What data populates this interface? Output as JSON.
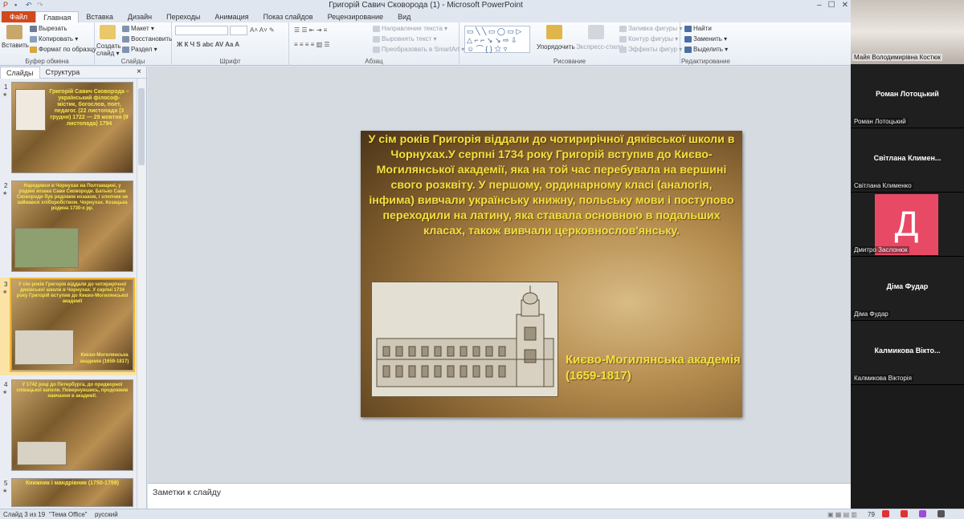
{
  "window": {
    "title": "Григорій Савич Сковорода (1) - Microsoft PowerPoint",
    "minimize": "–",
    "maximize": "☐",
    "close": "✕"
  },
  "tabs": {
    "file": "Файл",
    "items": [
      "Главная",
      "Вставка",
      "Дизайн",
      "Переходы",
      "Анимация",
      "Показ слайдов",
      "Рецензирование",
      "Вид"
    ]
  },
  "ribbon": {
    "clipboard": {
      "label": "Буфер обмена",
      "paste": "Вставить",
      "cut": "Вырезать",
      "copy": "Копировать ▾",
      "format_painter": "Формат по образцу"
    },
    "slides": {
      "label": "Слайды",
      "new_slide": "Создать слайд ▾",
      "layout": "Макет ▾",
      "reset": "Восстановить",
      "section": "Раздел ▾"
    },
    "font": {
      "label": "Шрифт"
    },
    "paragraph": {
      "label": "Абзац",
      "text_direction": "Направление текста ▾",
      "align_text": "Выровнять текст ▾",
      "smartart": "Преобразовать в SmartArt ▾"
    },
    "drawing": {
      "label": "Рисование",
      "arrange": "Упорядочить",
      "quick_styles": "Экспресс-стили",
      "fill": "Заливка фигуры ▾",
      "outline": "Контур фигуры ▾",
      "effects": "Эффекты фигур ▾"
    },
    "editing": {
      "label": "Редактирование",
      "find": "Найти",
      "replace": "Заменить ▾",
      "select": "Выделить ▾"
    }
  },
  "panel": {
    "tab_slides": "Слайды",
    "tab_outline": "Структура",
    "close": "×",
    "thumbnails": [
      {
        "number": "1",
        "text": "Григорій Савич Сковорода – український філософ-містик, богослов, поет, педагог. (22 листопада (3 грудня) 1722 — 29 жовтня (9 листопада) 1794"
      },
      {
        "number": "2",
        "text": "Народився в Чорнухах на Полтавщині, у родині козака Сави Сковороди. Батько Сави Сковороди був рядовим козаком, і хлопчик не займався хліборобством. Чорнухах. Козацька родина 1730-х рр."
      },
      {
        "number": "3",
        "text": "У сім років Григорія віддали до чотирирічної дяківської школи в Чорнухах. У серпні 1734 року Григорій вступив до Києво-Могилянської академії",
        "caption": "Києво-Могилянська академія (1659-1817)"
      },
      {
        "number": "4",
        "text": "У 1742 році до Петербурга, до придворної співацької капели. Повернувшись, продовжив навчання в академії."
      },
      {
        "number": "5",
        "text": "Книжник і мандрівник (1750-1759)"
      }
    ]
  },
  "slide": {
    "body": "У сім років Григорія віддали до чотирирічної дяківської школи в Чорнухах.У серпні 1734 року Григорій вступив до Києво-Могилянської академії, яка на той час перебувала на вершині свого розквіту. У першому, ординарному класі (аналогія, інфима) вивчали українську книжну, польську мови і поступово переходили на латину, яка ставала основною в подальших класах, також вивчали церковнослов'янську.",
    "caption": "Києво-Могилянська академія (1659-1817)"
  },
  "notes": {
    "placeholder": "Заметки к слайду"
  },
  "status": {
    "slide_of": "Слайд 3 из 19",
    "theme": "\"Тема Office\"",
    "language": "русский",
    "zoom": "79"
  },
  "participants": [
    {
      "name": "Майя Володимирівна Костюк",
      "display": "",
      "type": "camera"
    },
    {
      "name": "Роман Лотоцький",
      "display": "Роман Лотоцький",
      "type": "name"
    },
    {
      "name": "Світлана Клименко",
      "display": "Світлана Климен...",
      "type": "name"
    },
    {
      "name": "Дмитро Заслонюк",
      "display": "Д",
      "type": "avatar"
    },
    {
      "name": "Діма Фудар",
      "display": "Діма Фудар",
      "type": "name"
    },
    {
      "name": "Калмикова Вікторія",
      "display": "Калмикова Вікто...",
      "type": "name"
    }
  ],
  "colors": {
    "file_tab": "#d04a1e",
    "slide_text": "#f3e03d",
    "avatar": "#e84a66",
    "selected_thumb": "#f3b83a"
  }
}
